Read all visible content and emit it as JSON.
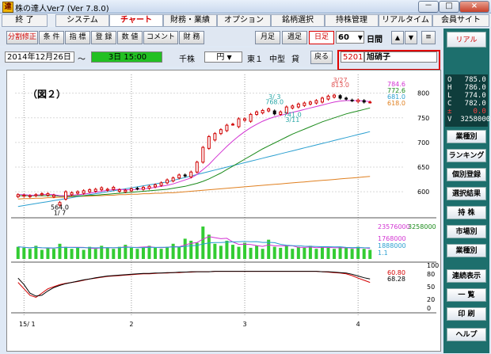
{
  "window": {
    "title": "株の達人Ver7 (Ver 7.8.0)",
    "icon_char": "達",
    "minimize": "－",
    "maximize": "□",
    "close": "×"
  },
  "menu": [
    "終 了",
    "システム",
    "チャート",
    "財務・業績",
    "オプション",
    "銘柄選択",
    "持株管理",
    "リアルタイム",
    "会員サイト"
  ],
  "toolbar": {
    "left_buttons": [
      "分割修正",
      "条 件",
      "指 標",
      "登 録",
      "数 値",
      "コメント",
      "財 務"
    ],
    "period_buttons": [
      "月足",
      "週足",
      "日足"
    ],
    "count_value": "60",
    "unit_label": "日間",
    "arrow_up": "▲",
    "arrow_down": "▼",
    "menu_icon": "≡",
    "real_button": "リアル"
  },
  "infobar": {
    "date": "2014年12月26日",
    "tilde": "～",
    "date_end": "3日 15:00",
    "unit": "千株",
    "currency": "円",
    "market": "東１",
    "size": "中型",
    "lend": "貸",
    "back_button": "戻る",
    "stock_code": "5201",
    "stock_name": "旭硝子"
  },
  "sidebar": {
    "ohlc": [
      {
        "key": "O",
        "value": "785.0"
      },
      {
        "key": "H",
        "value": "786.0"
      },
      {
        "key": "L",
        "value": "774.0"
      },
      {
        "key": "C",
        "value": "782.0"
      },
      {
        "key": "±",
        "value": "0.0"
      },
      {
        "key": "V",
        "value": "3258000"
      }
    ],
    "buttons": [
      "業種別",
      "ランキング",
      "個別登録",
      "選択結果",
      "持 株",
      "市場別",
      "業種別",
      "連続表示",
      "一 覧",
      "印 刷",
      "ヘルプ"
    ]
  },
  "chart_data": {
    "type": "line",
    "title": "（図２）",
    "x_tick_labels": [
      "15/ 1",
      "2",
      "3",
      "4"
    ],
    "price": {
      "ylim": [
        560,
        830
      ],
      "tick_labels": [
        "800",
        "750",
        "700",
        "650",
        "600"
      ],
      "candles": [
        {
          "o": 590,
          "c": 594
        },
        {
          "o": 591,
          "c": 593
        },
        {
          "o": 590,
          "c": 592
        },
        {
          "o": 592,
          "c": 594
        },
        {
          "o": 594,
          "c": 596
        },
        {
          "o": 593,
          "c": 596
        },
        {
          "o": 590,
          "c": 593
        },
        {
          "o": 573,
          "c": 578
        },
        {
          "o": 585,
          "c": 600
        },
        {
          "o": 594,
          "c": 598
        },
        {
          "o": 597,
          "c": 600
        },
        {
          "o": 597,
          "c": 602
        },
        {
          "o": 600,
          "c": 604
        },
        {
          "o": 601,
          "c": 605
        },
        {
          "o": 604,
          "c": 608
        },
        {
          "o": 603,
          "c": 605
        },
        {
          "o": 605,
          "c": 609
        },
        {
          "o": 601,
          "c": 604
        },
        {
          "o": 600,
          "c": 603
        },
        {
          "o": 602,
          "c": 606
        },
        {
          "o": 607,
          "c": 606
        },
        {
          "o": 605,
          "c": 609
        },
        {
          "o": 607,
          "c": 611
        },
        {
          "o": 610,
          "c": 614
        },
        {
          "o": 613,
          "c": 618
        },
        {
          "o": 618,
          "c": 624
        },
        {
          "o": 622,
          "c": 628
        },
        {
          "o": 628,
          "c": 634
        },
        {
          "o": 634,
          "c": 632
        },
        {
          "o": 630,
          "c": 640
        },
        {
          "o": 640,
          "c": 660
        },
        {
          "o": 660,
          "c": 690
        },
        {
          "o": 688,
          "c": 712
        },
        {
          "o": 705,
          "c": 718
        },
        {
          "o": 718,
          "c": 726
        },
        {
          "o": 724,
          "c": 735
        },
        {
          "o": 737,
          "c": 737
        },
        {
          "o": 732,
          "c": 748
        },
        {
          "o": 745,
          "c": 748
        },
        {
          "o": 743,
          "c": 757
        },
        {
          "o": 757,
          "c": 762
        },
        {
          "o": 760,
          "c": 765
        },
        {
          "o": 764,
          "c": 768
        },
        {
          "o": 764,
          "c": 758
        },
        {
          "o": 757,
          "c": 762
        },
        {
          "o": 760,
          "c": 772
        },
        {
          "o": 770,
          "c": 774
        },
        {
          "o": 772,
          "c": 778
        },
        {
          "o": 775,
          "c": 780
        },
        {
          "o": 778,
          "c": 782
        },
        {
          "o": 780,
          "c": 785
        },
        {
          "o": 782,
          "c": 790
        },
        {
          "o": 788,
          "c": 794
        },
        {
          "o": 792,
          "c": 796
        },
        {
          "o": 795,
          "c": 790
        },
        {
          "o": 790,
          "c": 788
        },
        {
          "o": 786,
          "c": 785
        },
        {
          "o": 783,
          "c": 786
        },
        {
          "o": 785,
          "c": 782
        },
        {
          "o": 782,
          "c": 782
        }
      ],
      "ma_short": [
        594,
        594,
        593,
        593,
        594,
        595,
        594,
        592,
        592,
        593,
        594,
        595,
        597,
        599,
        601,
        603,
        604,
        605,
        604,
        604,
        605,
        606,
        607,
        609,
        611,
        613,
        616,
        620,
        624,
        628,
        635,
        645,
        655,
        668,
        680,
        692,
        703,
        713,
        722,
        730,
        737,
        743,
        748,
        752,
        755,
        758,
        761,
        764,
        767,
        770,
        773,
        776,
        779,
        782,
        784,
        785,
        785,
        785,
        784,
        783
      ],
      "ma_mid": [
        592,
        592,
        592,
        592,
        592,
        592,
        592,
        591,
        591,
        591,
        592,
        592,
        593,
        593,
        594,
        595,
        596,
        597,
        598,
        599,
        600,
        601,
        602,
        603,
        604,
        605,
        607,
        609,
        611,
        614,
        617,
        621,
        626,
        632,
        638,
        645,
        652,
        659,
        666,
        673,
        680,
        687,
        693,
        699,
        705,
        711,
        717,
        722,
        727,
        732,
        737,
        742,
        746,
        750,
        754,
        758,
        761,
        764,
        767,
        770
      ],
      "ma_long": [
        570,
        572,
        574,
        576,
        578,
        580,
        582,
        584,
        586,
        588,
        590,
        592,
        594,
        596,
        598,
        600,
        602,
        604,
        606,
        608,
        610,
        612,
        614,
        616,
        618,
        620,
        623,
        626,
        629,
        632,
        635,
        638,
        641,
        644,
        647,
        650,
        653,
        656,
        659,
        662,
        665,
        668,
        671,
        674,
        677,
        680,
        683,
        686,
        689,
        692,
        695,
        698,
        701,
        704,
        707,
        710,
        713,
        716,
        719,
        722
      ],
      "ma_xlong": [
        585,
        586,
        586,
        587,
        587,
        588,
        588,
        589,
        589,
        590,
        590,
        591,
        591,
        592,
        592,
        593,
        593,
        594,
        594,
        595,
        595,
        596,
        596,
        597,
        597,
        598,
        598,
        599,
        600,
        601,
        602,
        603,
        604,
        605,
        606,
        607,
        608,
        609,
        610,
        611,
        612,
        613,
        614,
        615,
        616,
        617,
        618,
        619,
        620,
        621,
        622,
        623,
        624,
        625,
        626,
        627,
        628,
        629,
        630,
        631
      ],
      "annotations": [
        {
          "text": "564.0",
          "idx": 7,
          "v": 564,
          "color": "#000000"
        },
        {
          "text": "1/ 7",
          "idx": 7,
          "v": 553,
          "color": "#000000"
        },
        {
          "text": "3/ 3",
          "idx": 43,
          "v": 788,
          "color": "#2aa7a7"
        },
        {
          "text": "768.0",
          "idx": 43,
          "v": 778,
          "color": "#2aa7a7"
        },
        {
          "text": "741.0",
          "idx": 46,
          "v": 752,
          "color": "#2aa7a7"
        },
        {
          "text": "3/11",
          "idx": 46,
          "v": 742,
          "color": "#2aa7a7"
        },
        {
          "text": "3/27",
          "idx": 54,
          "v": 822,
          "color": "#e05050"
        },
        {
          "text": "813.0",
          "idx": 54,
          "v": 812,
          "color": "#e05050"
        }
      ],
      "right_values": [
        {
          "text": "784.6",
          "color": "#d233d2"
        },
        {
          "text": "772.6",
          "color": "#1a8a1a"
        },
        {
          "text": "681.0",
          "color": "#2a9fd0"
        },
        {
          "text": "618.0",
          "color": "#e08020"
        }
      ]
    },
    "volume": {
      "values": [
        1.2,
        1.1,
        1.0,
        1.3,
        0.9,
        1.1,
        1.0,
        1.5,
        1.2,
        1.0,
        1.1,
        0.9,
        1.2,
        1.0,
        1.3,
        1.1,
        1.0,
        1.2,
        1.4,
        1.1,
        1.0,
        1.2,
        1.3,
        1.1,
        1.0,
        1.2,
        1.5,
        1.2,
        2.0,
        1.8,
        1.6,
        3.2,
        2.4,
        1.5,
        1.3,
        1.8,
        1.4,
        1.2,
        1.6,
        1.1,
        1.3,
        1.0,
        1.9,
        1.2,
        1.1,
        1.3,
        1.0,
        1.2,
        1.1,
        1.3,
        1.0,
        1.2,
        1.1,
        1.0,
        1.2,
        1.1,
        1.0,
        1.2,
        1.0,
        0.9
      ],
      "right_values": [
        {
          "text": "23576000",
          "color": "#d233d2"
        },
        {
          "text": "3258000",
          "color": "#1a8a1a"
        },
        {
          "text": "1768000",
          "color": "#d233d2"
        },
        {
          "text": "1888000",
          "color": "#2a9fd0"
        },
        {
          "text": "1.1",
          "color": "#2a9fd0"
        }
      ]
    },
    "oscillator": {
      "ylim": [
        0,
        100
      ],
      "tick_labels": [
        "100",
        "80",
        "50",
        "20",
        "0"
      ],
      "line_red": [
        60,
        45,
        30,
        25,
        35,
        45,
        50,
        55,
        58,
        60,
        62,
        65,
        68,
        70,
        72,
        74,
        75,
        76,
        77,
        78,
        79,
        80,
        80,
        81,
        82,
        82,
        83,
        83,
        84,
        84,
        85,
        85,
        85,
        86,
        86,
        86,
        86,
        86,
        86,
        86,
        86,
        86,
        86,
        86,
        86,
        86,
        86,
        86,
        86,
        86,
        86,
        85,
        84,
        83,
        82,
        80,
        76,
        70,
        65,
        60
      ],
      "line_black": [
        70,
        55,
        35,
        28,
        30,
        40,
        48,
        53,
        57,
        60,
        63,
        66,
        68,
        71,
        73,
        75,
        76,
        77,
        78,
        79,
        80,
        81,
        81,
        82,
        82,
        83,
        83,
        84,
        84,
        85,
        85,
        85,
        85,
        86,
        86,
        86,
        86,
        86,
        86,
        86,
        86,
        86,
        86,
        86,
        86,
        86,
        86,
        86,
        86,
        86,
        86,
        85,
        85,
        84,
        83,
        82,
        79,
        75,
        71,
        68
      ],
      "right_values": [
        {
          "text": "60.80",
          "color": "#d40000"
        },
        {
          "text": "68.28",
          "color": "#000000"
        }
      ]
    }
  }
}
